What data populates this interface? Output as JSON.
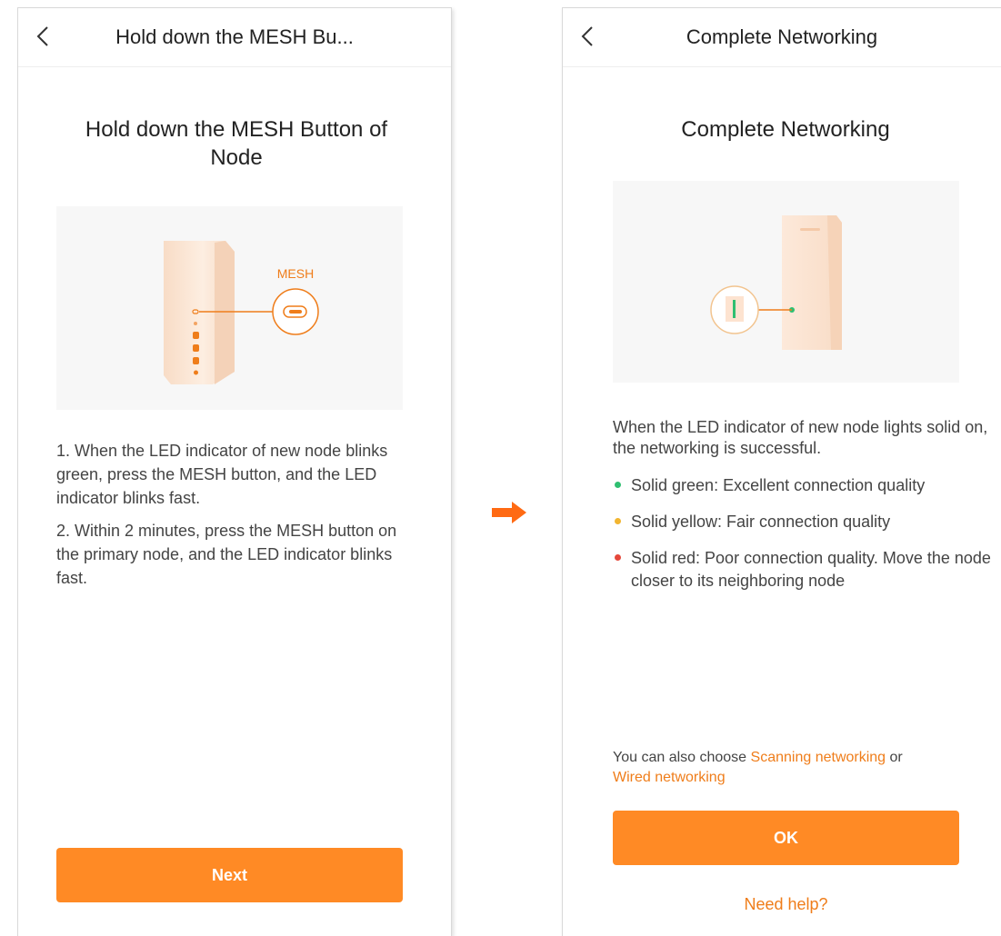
{
  "colors": {
    "accent": "#ff8a25",
    "link": "#ef7d1a",
    "led_green": "#2fbf71",
    "led_yellow": "#f2b530",
    "led_red": "#e5483b"
  },
  "left": {
    "nav_title": "Hold down the MESH Bu...",
    "heading": "Hold down the MESH Button of Node",
    "illustration_label": "MESH",
    "steps": [
      "1. When the LED indicator of new node blinks green, press the MESH button, and the LED indicator blinks fast.",
      "2. Within 2 minutes, press the MESH button on the primary node, and the LED indicator blinks fast."
    ],
    "next_button": "Next"
  },
  "right": {
    "nav_title": "Complete Networking",
    "heading": "Complete Networking",
    "intro": "When the LED indicator of new node lights solid on, the networking is successful.",
    "bullets": [
      {
        "text": "Solid green: Excellent connection quality",
        "color": "#2fbf71"
      },
      {
        "text": "Solid yellow: Fair connection quality",
        "color": "#f2b530"
      },
      {
        "text": "Solid red: Poor connection quality. Move the node closer to its neighboring node",
        "color": "#e5483b"
      }
    ],
    "alt_prefix": "You can also choose ",
    "alt_link1": "Scanning networking",
    "alt_mid": " or",
    "alt_link2": "Wired networking",
    "ok_button": "OK",
    "help_link": "Need help?"
  }
}
